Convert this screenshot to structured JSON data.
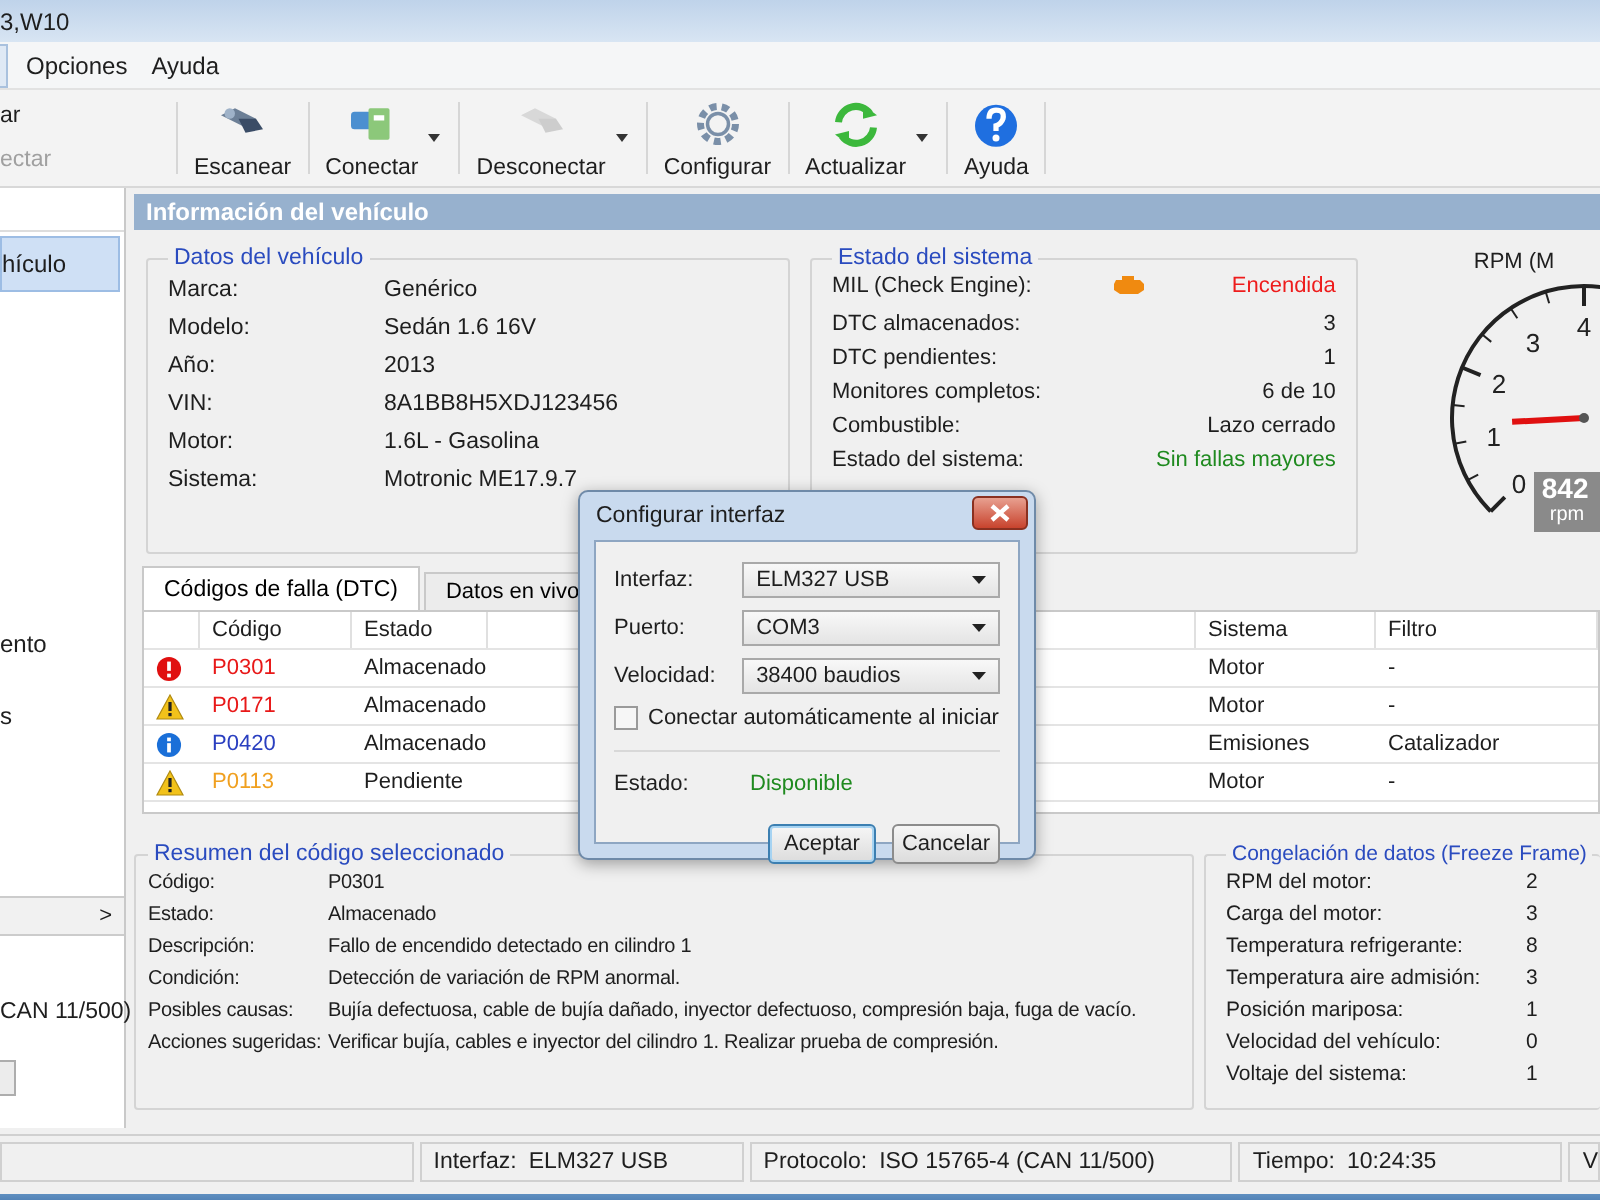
{
  "window": {
    "title": "3,W10"
  },
  "menu": [
    {
      "label": "Opciones"
    },
    {
      "label": "Ayuda"
    }
  ],
  "toolbar": {
    "cut_items": [
      {
        "label": "ar",
        "disabled": false
      },
      {
        "label": "ectar",
        "disabled": true
      }
    ],
    "buttons": [
      {
        "kind": "scan",
        "label": "Escanear",
        "disabled": false,
        "dropdown": false
      },
      {
        "kind": "connect",
        "label": "Conectar",
        "disabled": false,
        "dropdown": true
      },
      {
        "kind": "disconnect",
        "label": "Desconectar",
        "disabled": true,
        "dropdown": true
      },
      {
        "kind": "settings",
        "label": "Configurar",
        "disabled": false,
        "dropdown": false
      },
      {
        "kind": "refresh",
        "label": "Actualizar",
        "disabled": false,
        "dropdown": true
      },
      {
        "kind": "help",
        "label": "Ayuda",
        "disabled": false,
        "dropdown": false
      }
    ]
  },
  "sidebar": {
    "items": [
      {
        "label": "hículo",
        "selected": true
      },
      {
        "label": "ento",
        "selected": false
      },
      {
        "label": "s",
        "selected": false
      }
    ],
    "section": {
      "arrow": ">",
      "text": "CAN 11/500)"
    }
  },
  "panel": {
    "title": "Información del vehículo"
  },
  "vehicle": {
    "title": "Datos del vehículo",
    "rows": [
      {
        "label": "Marca:",
        "value": "Genérico"
      },
      {
        "label": "Modelo:",
        "value": "Sedán 1.6 16V"
      },
      {
        "label": "Año:",
        "value": "2013"
      },
      {
        "label": "VIN:",
        "value": "8A1BB8H5XDJ123456"
      },
      {
        "label": "Motor:",
        "value": "1.6L - Gasolina"
      },
      {
        "label": "Sistema:",
        "value": "Motronic ME17.9.7"
      }
    ]
  },
  "system_status": {
    "title": "Estado del sistema",
    "rows": [
      {
        "label": "MIL (Check Engine):",
        "value": "Encendida",
        "kind": "alert",
        "engine_icon": true
      },
      {
        "label": "DTC almacenados:",
        "value": "3",
        "kind": "normal",
        "engine_icon": false
      },
      {
        "label": "DTC pendientes:",
        "value": "1",
        "kind": "normal",
        "engine_icon": false
      },
      {
        "label": "Monitores completos:",
        "value": "6 de 10",
        "kind": "normal",
        "engine_icon": false
      },
      {
        "label": "Combustible:",
        "value": "Lazo cerrado",
        "kind": "normal",
        "engine_icon": false
      },
      {
        "label": "Estado del sistema:",
        "value": "Sin fallas mayores",
        "kind": "ok",
        "engine_icon": false
      }
    ]
  },
  "gauge": {
    "title": "RPM (M",
    "ticks": [
      "0",
      "1",
      "2",
      "3",
      "4"
    ],
    "reading": "842",
    "unit": "rpm"
  },
  "dtc": {
    "tabs": [
      {
        "label": "Códigos de falla (DTC)",
        "selected": true
      },
      {
        "label": "Datos en vivo",
        "selected": false
      }
    ],
    "columns": [
      "Código",
      "Estado",
      "Sistema",
      "Filtro"
    ],
    "rows": [
      {
        "kind": "error",
        "code": "P0301",
        "color": "#e81818",
        "status": "Almacenado",
        "system": "Motor",
        "filter": "-"
      },
      {
        "kind": "warning",
        "code": "P0171",
        "color": "#e81818",
        "status": "Almacenado",
        "system": "Motor",
        "filter": "-"
      },
      {
        "kind": "info",
        "code": "P0420",
        "color": "#2a3fc0",
        "status": "Almacenado",
        "system": "Emisiones",
        "filter": "Catalizador"
      },
      {
        "kind": "warning",
        "code": "P0113",
        "color": "#f0a020",
        "status": "Pendiente",
        "system": "Motor",
        "filter": "-"
      }
    ]
  },
  "summary": {
    "title": "Resumen del código seleccionado",
    "rows": [
      {
        "label": "Código:",
        "value": "P0301"
      },
      {
        "label": "Estado:",
        "value": "Almacenado"
      },
      {
        "label": "Descripción:",
        "value": "Fallo de encendido detectado en cilindro 1"
      },
      {
        "label": "Condición:",
        "value": "Detección de variación de RPM anormal."
      },
      {
        "label": "Posibles causas:",
        "value": "Bujía defectuosa, cable de bujía dañado, inyector defectuoso, compresión baja, fuga de vacío."
      },
      {
        "label": "Acciones sugeridas:",
        "value": "Verificar bujía, cables e inyector del cilindro 1. Realizar prueba de compresión."
      }
    ]
  },
  "freeze_frame": {
    "title": "Congelación de datos (Freeze Frame)",
    "rows": [
      {
        "label": "RPM del motor:",
        "value": "2"
      },
      {
        "label": "Carga del motor:",
        "value": "3"
      },
      {
        "label": "Temperatura refrigerante:",
        "value": "8"
      },
      {
        "label": "Temperatura aire admisión:",
        "value": "3"
      },
      {
        "label": "Posición mariposa:",
        "value": "1"
      },
      {
        "label": "Velocidad del vehículo:",
        "value": "0"
      },
      {
        "label": "Voltaje del sistema:",
        "value": "1"
      }
    ]
  },
  "status_bar": [
    {
      "label": "Interfaz:",
      "value": "ELM327 USB"
    },
    {
      "label": "Protocolo:",
      "value": "ISO 15765-4 (CAN 11/500)"
    },
    {
      "label": "Tiempo:",
      "value": "10:24:35"
    },
    {
      "label": "V"
    }
  ],
  "dialog": {
    "title": "Configurar interfaz",
    "fields": [
      {
        "label": "Interfaz:",
        "value": "ELM327 USB"
      },
      {
        "label": "Puerto:",
        "value": "COM3"
      },
      {
        "label": "Velocidad:",
        "value": "38400 baudios"
      }
    ],
    "checkbox": {
      "label": "Conectar automáticamente al iniciar",
      "checked": false
    },
    "status": {
      "label": "Estado:",
      "value": "Disponible"
    },
    "buttons": [
      {
        "label": "Aceptar",
        "default": true
      },
      {
        "label": "Cancelar",
        "default": false
      }
    ]
  }
}
